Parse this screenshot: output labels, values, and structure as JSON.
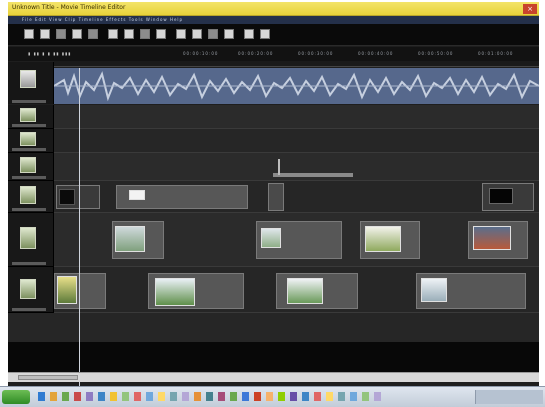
{
  "window": {
    "title": "Unknown Title - Movie Timeline Editor",
    "close_label": "×"
  },
  "menubar": {
    "text": "File Edit View Clip Timeline Effects Tools Window Help"
  },
  "subbar": {
    "labels": [
      "00:00:10:00",
      "00:00:20:00",
      "00:00:30:00",
      "00:00:40:00",
      "00:00:50:00",
      "00:01:00:00"
    ]
  },
  "colors": {
    "titlebar": "#e8d23a",
    "audio_track": "#5a6a8c",
    "clip": "#575757",
    "background": "#1e1e1e"
  },
  "icons": [
    "track-video-icon",
    "audio-track-icon",
    "window-close-icon",
    "start-button-icon"
  ]
}
